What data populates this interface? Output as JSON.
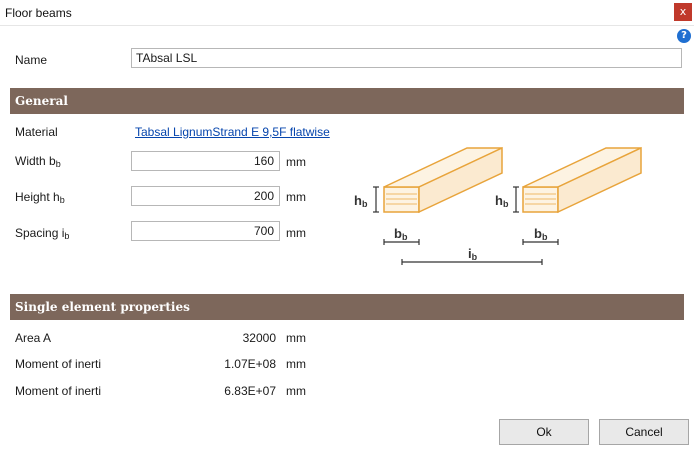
{
  "window": {
    "title": "Floor beams",
    "close_label": "x",
    "help_label": "?"
  },
  "name_field": {
    "label": "Name",
    "value": "TAbsal LSL"
  },
  "general": {
    "title": "General",
    "material": {
      "label": "Material",
      "value": "Tabsal LignumStrand E 9,5F flatwise"
    },
    "width": {
      "label_main": "Width b",
      "label_sub": "b",
      "value": "160",
      "unit": "mm"
    },
    "height": {
      "label_main": "Height h",
      "label_sub": "b",
      "value": "200",
      "unit": "mm"
    },
    "spacing": {
      "label_main": "Spacing i",
      "label_sub": "b",
      "value": "700",
      "unit": "mm"
    }
  },
  "diagram": {
    "h_label_main": "h",
    "h_label_sub": "b",
    "b_label_main": "b",
    "b_label_sub": "b",
    "i_label_main": "i",
    "i_label_sub": "b",
    "beam_color": "#e8a43b"
  },
  "properties": {
    "title": "Single element properties",
    "rows": [
      {
        "label": "Area A",
        "value": "32000",
        "unit": "mm"
      },
      {
        "label": "Moment of inerti",
        "value": "1.07E+08",
        "unit": "mm"
      },
      {
        "label": "Moment of inerti",
        "value": "6.83E+07",
        "unit": "mm"
      }
    ]
  },
  "buttons": {
    "ok": "Ok",
    "cancel": "Cancel"
  },
  "colors": {
    "section_header": "#7d675b",
    "close_button": "#c0392b",
    "help_icon": "#1f6fd1",
    "link": "#0645ad"
  }
}
